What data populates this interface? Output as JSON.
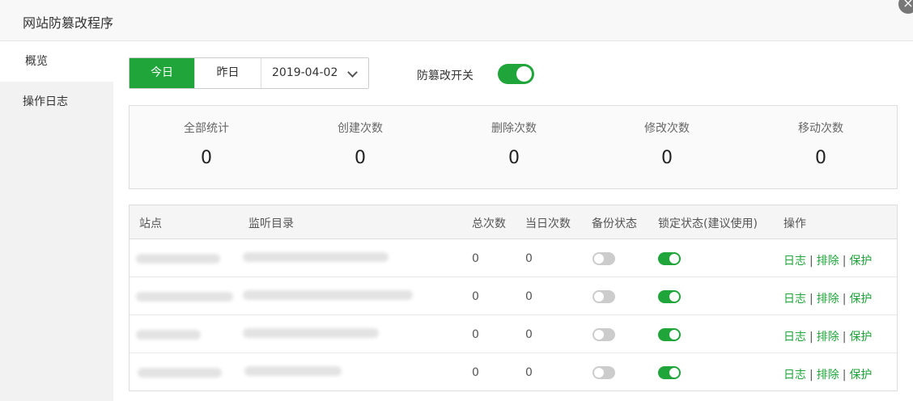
{
  "dialog": {
    "title": "网站防篡改程序",
    "close_symbol": "×"
  },
  "sidebar": {
    "items": [
      {
        "label": "概览",
        "active": true
      },
      {
        "label": "操作日志",
        "active": false
      }
    ]
  },
  "toolbar": {
    "today_label": "今日",
    "yesterday_label": "昨日",
    "date_value": "2019-04-02",
    "tamper_switch_label": "防篡改开关",
    "tamper_switch_on": true
  },
  "stats": [
    {
      "label": "全部统计",
      "value": "0"
    },
    {
      "label": "创建次数",
      "value": "0"
    },
    {
      "label": "删除次数",
      "value": "0"
    },
    {
      "label": "修改次数",
      "value": "0"
    },
    {
      "label": "移动次数",
      "value": "0"
    }
  ],
  "table": {
    "headers": [
      "站点",
      "监听目录",
      "总次数",
      "当日次数",
      "备份状态",
      "锁定状态(建议使用)",
      "操作"
    ],
    "rows": [
      {
        "total": "0",
        "today": "0",
        "backup_on": false,
        "lock_on": true
      },
      {
        "total": "0",
        "today": "0",
        "backup_on": false,
        "lock_on": true
      },
      {
        "total": "0",
        "today": "0",
        "backup_on": false,
        "lock_on": true
      },
      {
        "total": "0",
        "today": "0",
        "backup_on": false,
        "lock_on": true
      }
    ],
    "actions": {
      "log": "日志",
      "exclude": "排除",
      "protect": "保护",
      "separator": "|"
    }
  },
  "colors": {
    "accent": "#20a53a",
    "switch_off": "#cccccc"
  }
}
